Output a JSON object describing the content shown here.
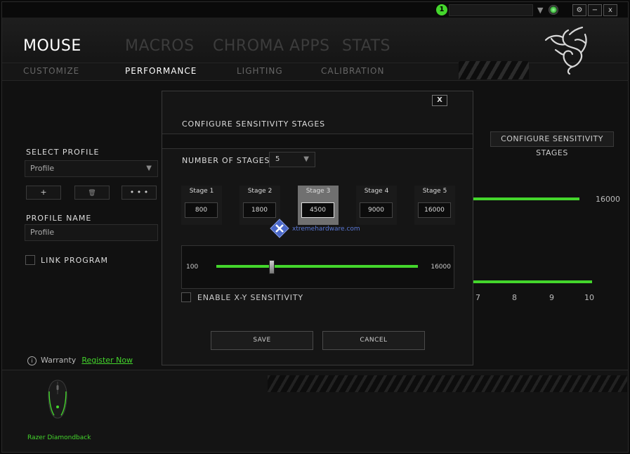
{
  "titlebar": {
    "notification_count": "1",
    "settings_label": "⚙",
    "minimize_label": "−",
    "close_label": "x"
  },
  "nav": {
    "main": [
      "MOUSE",
      "MACROS",
      "CHROMA APPS",
      "STATS"
    ],
    "sub": [
      "CUSTOMIZE",
      "PERFORMANCE",
      "LIGHTING",
      "CALIBRATION"
    ],
    "active_main": "MOUSE",
    "active_sub": "PERFORMANCE"
  },
  "profile": {
    "select_label": "SELECT PROFILE",
    "selected": "Profile",
    "add_label": "+",
    "delete_label": "🗑",
    "more_label": "• • •",
    "name_label": "PROFILE NAME",
    "name_value": "Profile",
    "link_program_label": "LINK PROGRAM"
  },
  "background_panel": {
    "configure_button": "CONFIGURE SENSITIVITY STAGES",
    "max_value": "16000",
    "ticks": [
      "7",
      "8",
      "9",
      "10"
    ]
  },
  "footer": {
    "warranty_label": "Warranty",
    "register_label": "Register Now",
    "device_name": "Razer Diamondback"
  },
  "modal": {
    "close_label": "X",
    "title": "CONFIGURE SENSITIVITY STAGES",
    "number_of_stages_label": "NUMBER OF STAGES",
    "number_of_stages_value": "5",
    "stages": [
      {
        "name": "Stage 1",
        "value": "800"
      },
      {
        "name": "Stage 2",
        "value": "1800"
      },
      {
        "name": "Stage 3",
        "value": "4500"
      },
      {
        "name": "Stage 4",
        "value": "9000"
      },
      {
        "name": "Stage 5",
        "value": "16000"
      }
    ],
    "active_stage": 3,
    "slider": {
      "min": "100",
      "max": "16000",
      "value": 4500
    },
    "xy_label": "ENABLE X-Y SENSITIVITY",
    "save_label": "SAVE",
    "cancel_label": "CANCEL"
  },
  "watermark": {
    "text": "xtremehardware.com"
  },
  "colors": {
    "accent": "#44d62c",
    "watermark": "#5a78d6"
  }
}
